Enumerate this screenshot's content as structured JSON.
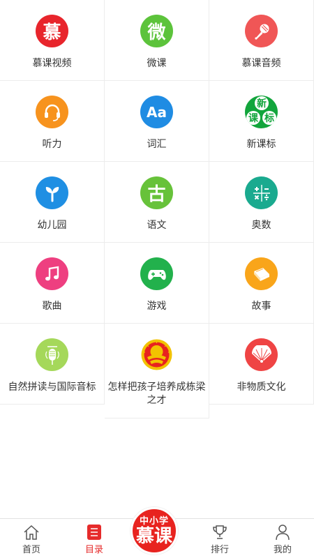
{
  "categories": [
    {
      "label": "慕课视频",
      "icon": "mu-character-icon",
      "glyph": "慕",
      "color": "#e8252c"
    },
    {
      "label": "微课",
      "icon": "wei-character-icon",
      "glyph": "微",
      "color": "#5cc33b"
    },
    {
      "label": "慕课音频",
      "icon": "microphone-icon",
      "color": "#f05656"
    },
    {
      "label": "听力",
      "icon": "headset-icon",
      "color": "#f7931e"
    },
    {
      "label": "词汇",
      "icon": "font-aa-icon",
      "glyph": "Aa",
      "color": "#1f8ce3"
    },
    {
      "label": "新课标",
      "icon": "new-curriculum-icon",
      "glyphs": [
        "新",
        "课",
        "标"
      ],
      "color": "#12a53c"
    },
    {
      "label": "幼儿园",
      "icon": "sprout-icon",
      "color": "#1f8fe3"
    },
    {
      "label": "语文",
      "icon": "chinese-ancient-icon",
      "glyph": "古",
      "color": "#67c23a"
    },
    {
      "label": "奥数",
      "icon": "math-symbols-icon",
      "color": "#1aaa8f"
    },
    {
      "label": "歌曲",
      "icon": "music-note-icon",
      "color": "#ee3f80"
    },
    {
      "label": "游戏",
      "icon": "gamepad-icon",
      "color": "#22b14c"
    },
    {
      "label": "故事",
      "icon": "book-icon",
      "color": "#f9a51a"
    },
    {
      "label": "自然拼读与国际音标",
      "icon": "vintage-microphone-icon",
      "color": "#a5d85a"
    },
    {
      "label": "怎样把孩子培养成栋梁之才",
      "icon": "emblem-icon",
      "color": "#e8231f"
    },
    {
      "label": "非物质文化",
      "icon": "folding-fan-icon",
      "color": "#ef4444"
    }
  ],
  "bottom_nav": {
    "home": "首页",
    "catalog": "目录",
    "ranking": "排行",
    "mine": "我的",
    "logo_small": "中小学",
    "logo_big": "慕课"
  },
  "colors": {
    "accent": "#e62b2b",
    "divider": "#ececec"
  }
}
